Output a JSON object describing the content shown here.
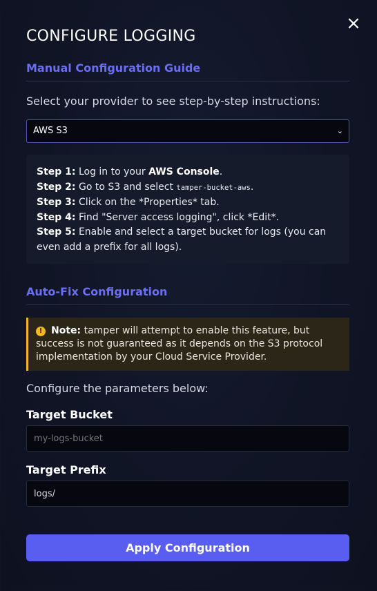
{
  "modal": {
    "title": "CONFIGURE LOGGING",
    "close_icon": "×"
  },
  "manual_guide": {
    "heading": "Manual Configuration Guide",
    "provider_prompt": "Select your provider to see step-by-step instructions:",
    "provider_select": {
      "value": "AWS S3",
      "chevron": "⌄"
    },
    "steps": [
      {
        "label": "Step 1:",
        "text_before": " Log in to your ",
        "strong": "AWS Console",
        "text_after": "."
      },
      {
        "label": "Step 2:",
        "text_before": " Go to S3 and select ",
        "code": "tamper-bucket-aws",
        "text_after": "."
      },
      {
        "label": "Step 3:",
        "text": " Click on the *Properties* tab."
      },
      {
        "label": "Step 4:",
        "text": " Find \"Server access logging\", click *Edit*."
      },
      {
        "label": "Step 5:",
        "text": " Enable and select a target bucket for logs (you can even add a prefix for all logs)."
      }
    ]
  },
  "auto_fix": {
    "heading": "Auto-Fix Configuration",
    "note": {
      "icon": "info-icon",
      "label": "Note:",
      "text": " tamper will attempt to enable this feature, but success is not guaranteed as it depends on the S3 protocol implementation by your Cloud Service Provider.",
      "accent_color": "#f2b620"
    },
    "params_prompt": "Configure the parameters below:",
    "target_bucket": {
      "label": "Target Bucket",
      "placeholder": "my-logs-bucket"
    },
    "target_prefix": {
      "label": "Target Prefix",
      "value": "logs/"
    },
    "apply_label": "Apply Configuration"
  },
  "colors": {
    "accent": "#5a5ef0",
    "heading": "#6b6ef5",
    "warning": "#f2b620"
  }
}
